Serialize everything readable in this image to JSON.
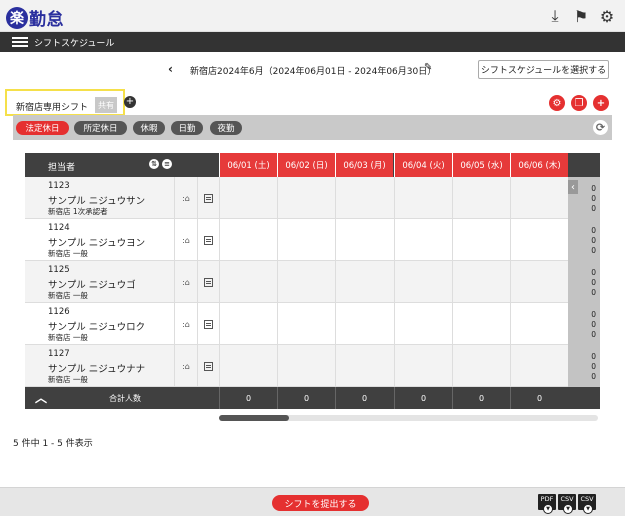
{
  "app": {
    "logo_char": "楽",
    "logo_text": "楽勤怠"
  },
  "header_icons": [
    "download-tray-icon",
    "flag-icon",
    "gear-icon"
  ],
  "nav": {
    "title": "シフトスケジュール"
  },
  "period": {
    "text": "新宿店2024年6月（2024年06月01日 - 2024年06月30日）",
    "prev": "‹",
    "select_label": "シフトスケジュールを選択する"
  },
  "tab": {
    "label": "新宿店専用シフト",
    "badge": "共有",
    "add": "+"
  },
  "filters": [
    {
      "label": "法定休日",
      "color": "#e53030"
    },
    {
      "label": "所定休日",
      "color": "#555555"
    },
    {
      "label": "休暇",
      "color": "#555555"
    },
    {
      "label": "日勤",
      "color": "#555555"
    },
    {
      "label": "夜勤",
      "color": "#555555"
    }
  ],
  "table": {
    "header_name": "担当者",
    "dates": [
      "06/01 (土)",
      "06/02 (日)",
      "06/03 (月)",
      "06/04 (火)",
      "06/05 (水)",
      "06/06 (木)"
    ],
    "rows": [
      {
        "id": "1123",
        "name": "サンプル ニジュウサン",
        "role": "新宿店 1次承認者",
        "sums": [
          "0",
          "0",
          "0"
        ]
      },
      {
        "id": "1124",
        "name": "サンプル ニジュウヨン",
        "role": "新宿店 一般",
        "sums": [
          "0",
          "0",
          "0"
        ]
      },
      {
        "id": "1125",
        "name": "サンプル ニジュウゴ",
        "role": "新宿店 一般",
        "sums": [
          "0",
          "0",
          "0"
        ]
      },
      {
        "id": "1126",
        "name": "サンプル ニジュウロク",
        "role": "新宿店 一般",
        "sums": [
          "0",
          "0",
          "0"
        ]
      },
      {
        "id": "1127",
        "name": "サンプル ニジュウナナ",
        "role": "新宿店 一般",
        "sums": [
          "0",
          "0",
          "0"
        ]
      }
    ],
    "total_label": "合計人数",
    "totals": [
      "0",
      "0",
      "0",
      "0",
      "0",
      "0"
    ]
  },
  "pagination": {
    "text": "5 件中 1 - 5 件表示"
  },
  "footer": {
    "submit_label": "シフトを提出する",
    "downloads": [
      "PDF",
      "CSV",
      "CSV"
    ]
  },
  "colors": {
    "accent": "#e53030",
    "brand": "#2a2f9e",
    "dark": "#404040"
  }
}
